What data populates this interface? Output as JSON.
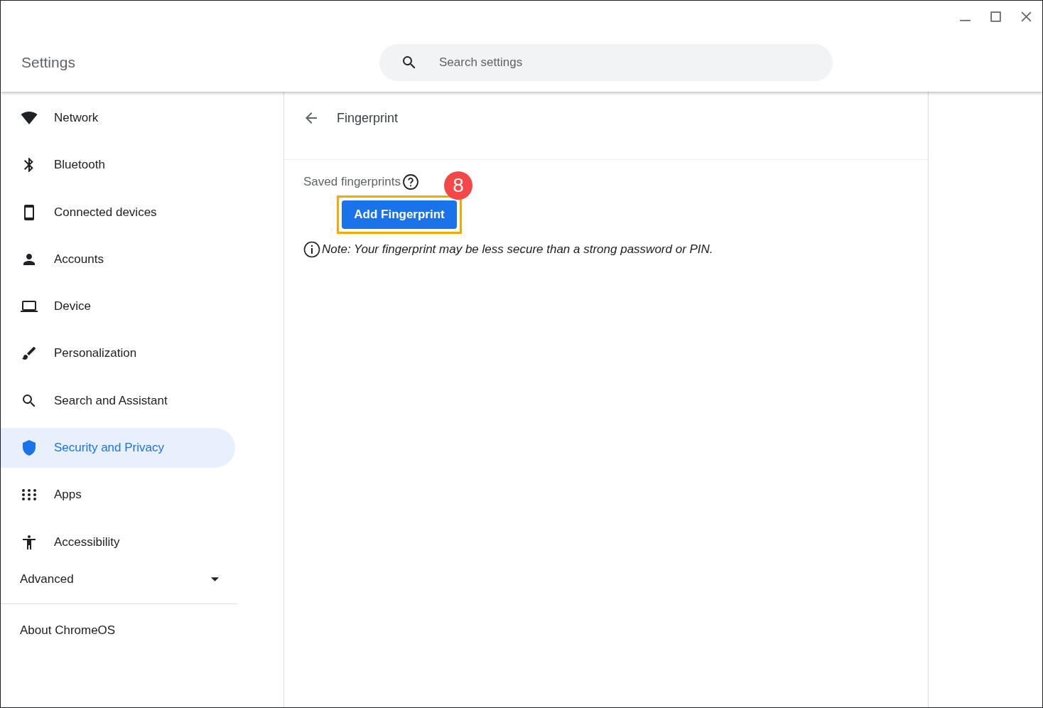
{
  "window": {
    "title": "Settings"
  },
  "search": {
    "placeholder": "Search settings"
  },
  "sidebar": {
    "items": [
      {
        "label": "Network",
        "selected": false
      },
      {
        "label": "Bluetooth",
        "selected": false
      },
      {
        "label": "Connected devices",
        "selected": false
      },
      {
        "label": "Accounts",
        "selected": false
      },
      {
        "label": "Device",
        "selected": false
      },
      {
        "label": "Personalization",
        "selected": false
      },
      {
        "label": "Search and Assistant",
        "selected": false
      },
      {
        "label": "Security and Privacy",
        "selected": true
      },
      {
        "label": "Apps",
        "selected": false
      },
      {
        "label": "Accessibility",
        "selected": false
      }
    ],
    "advanced": {
      "label": "Advanced",
      "expanded": false
    },
    "about": "About ChromeOS"
  },
  "page": {
    "title": "Fingerprint",
    "section_label": "Saved fingerprints",
    "button": {
      "label": "Add Fingerprint",
      "highlighted": true
    },
    "step_marker": "8",
    "note": "Note: Your fingerprint may be less secure than a strong password or PIN."
  }
}
